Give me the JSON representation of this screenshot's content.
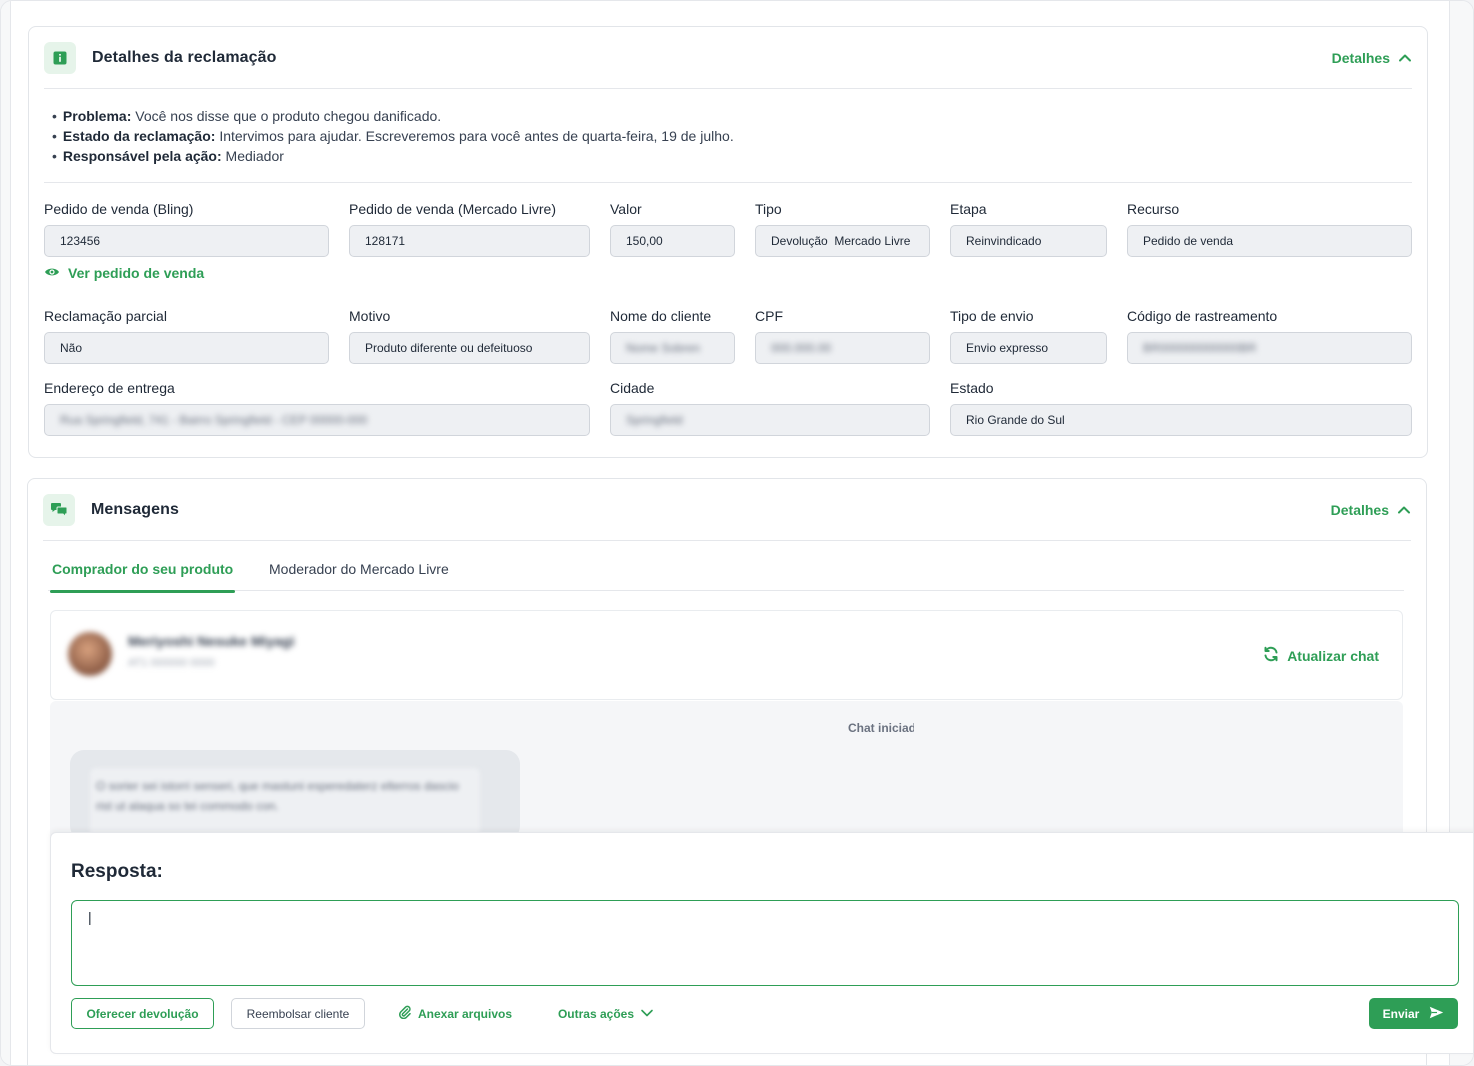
{
  "complaint": {
    "title": "Detalhes da reclamação",
    "toggle_label": "Detalhes",
    "bullets": {
      "problem_label": "Problema:",
      "problem_text": "Você nos disse que o produto chegou danificado.",
      "status_label": "Estado da reclamação:",
      "status_text": "Intervimos para ajudar. Escreveremos para você antes de quarta-feira, 19 de julho.",
      "responsible_label": "Responsável pela ação:",
      "responsible_text": "Mediador"
    },
    "fields": {
      "order_bling": {
        "label": "Pedido de venda (Bling)",
        "value": "123456"
      },
      "order_ml": {
        "label": "Pedido de venda (Mercado Livre)",
        "value": "128171"
      },
      "amount": {
        "label": "Valor",
        "value": "150,00"
      },
      "type": {
        "label": "Tipo",
        "value": "Devolução  Mercado Livre"
      },
      "stage": {
        "label": "Etapa",
        "value": "Reinvindicado"
      },
      "resource": {
        "label": "Recurso",
        "value": "Pedido de venda"
      },
      "partial": {
        "label": "Reclamação parcial",
        "value": "Não"
      },
      "reason": {
        "label": "Motivo",
        "value": "Produto diferente ou defeituoso"
      },
      "customer_name": {
        "label": "Nome do cliente",
        "value": "Nome Sobren"
      },
      "cpf": {
        "label": "CPF",
        "value": "000.000.00"
      },
      "shipping_type": {
        "label": "Tipo de envio",
        "value": "Envio expresso"
      },
      "tracking": {
        "label": "Código de rastreamento",
        "value": "BR000000000000BR"
      },
      "address": {
        "label": "Endereço de entrega",
        "value": "Rua Springfield, 741 - Bairro Springfield - CEP 00000-000"
      },
      "city": {
        "label": "Cidade",
        "value": "Springfield"
      },
      "state": {
        "label": "Estado",
        "value": "Rio Grande do Sul"
      }
    },
    "view_order_link": "Ver pedido de venda"
  },
  "messages": {
    "title": "Mensagens",
    "toggle_label": "Detalhes",
    "tabs": [
      {
        "label": "Comprador do seu produto",
        "active": true
      },
      {
        "label": "Moderador do Mercado Livre",
        "active": false
      }
    ],
    "chat": {
      "contact_name": "Meriyoshi Nesuke Miyagi",
      "contact_sub": "AT1 000000 0000",
      "refresh_label": "Atualizar chat",
      "started_label": "Chat iniciado",
      "message_text": "O sorier sei istorri senseri, que mastuni esperedaterz elterros dascio rist ut alaqua so tei commodo con."
    }
  },
  "reply": {
    "title": "Resposta:",
    "value": "|",
    "buttons": {
      "offer_return": "Oferecer devolução",
      "refund": "Reembolsar cliente",
      "attach": "Anexar arquivos",
      "other_actions": "Outras ações",
      "send": "Enviar"
    }
  },
  "colors": {
    "accent": "#2e9e56",
    "input_bg": "#eef0f3",
    "border": "#d1d5db"
  },
  "icons": [
    "info-icon",
    "chevron-up-icon",
    "eye-icon",
    "chat-bubbles-icon",
    "refresh-icon",
    "paperclip-icon",
    "chevron-down-icon",
    "send-icon"
  ]
}
